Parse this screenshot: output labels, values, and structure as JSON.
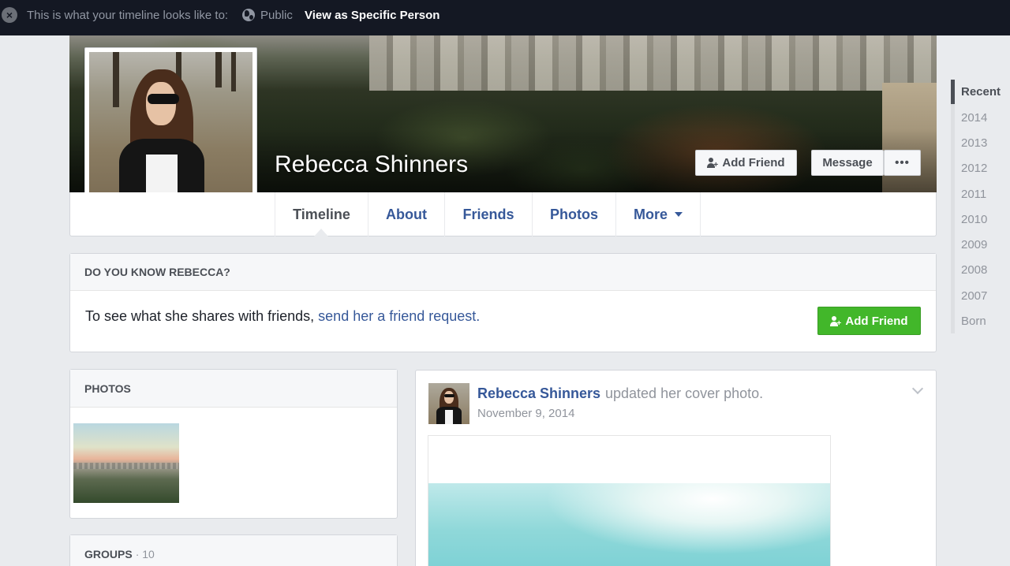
{
  "banner": {
    "message": "This is what your timeline looks like to:",
    "audience": "Public",
    "view_as": "View as Specific Person"
  },
  "profile": {
    "name": "Rebecca Shinners",
    "add_friend_label": "Add Friend",
    "message_label": "Message",
    "more_label": "•••"
  },
  "nav": {
    "tabs": [
      {
        "label": "Timeline"
      },
      {
        "label": "About"
      },
      {
        "label": "Friends"
      },
      {
        "label": "Photos"
      },
      {
        "label": "More"
      }
    ]
  },
  "know_card": {
    "heading": "DO YOU KNOW REBECCA?",
    "text": "To see what she shares with friends,",
    "link": "send her a friend request.",
    "button": "Add Friend"
  },
  "photos_card": {
    "heading": "PHOTOS"
  },
  "groups_card": {
    "heading": "GROUPS",
    "count": "· 10"
  },
  "post": {
    "author": "Rebecca Shinners",
    "action": "updated her cover photo.",
    "date": "November 9, 2014"
  },
  "years": [
    "Recent",
    "2014",
    "2013",
    "2012",
    "2011",
    "2010",
    "2009",
    "2008",
    "2007",
    "Born"
  ],
  "colors": {
    "banner_bg": "#141823",
    "link_blue": "#365899",
    "green_button": "#42b72a",
    "page_bg": "#e9ebee"
  }
}
